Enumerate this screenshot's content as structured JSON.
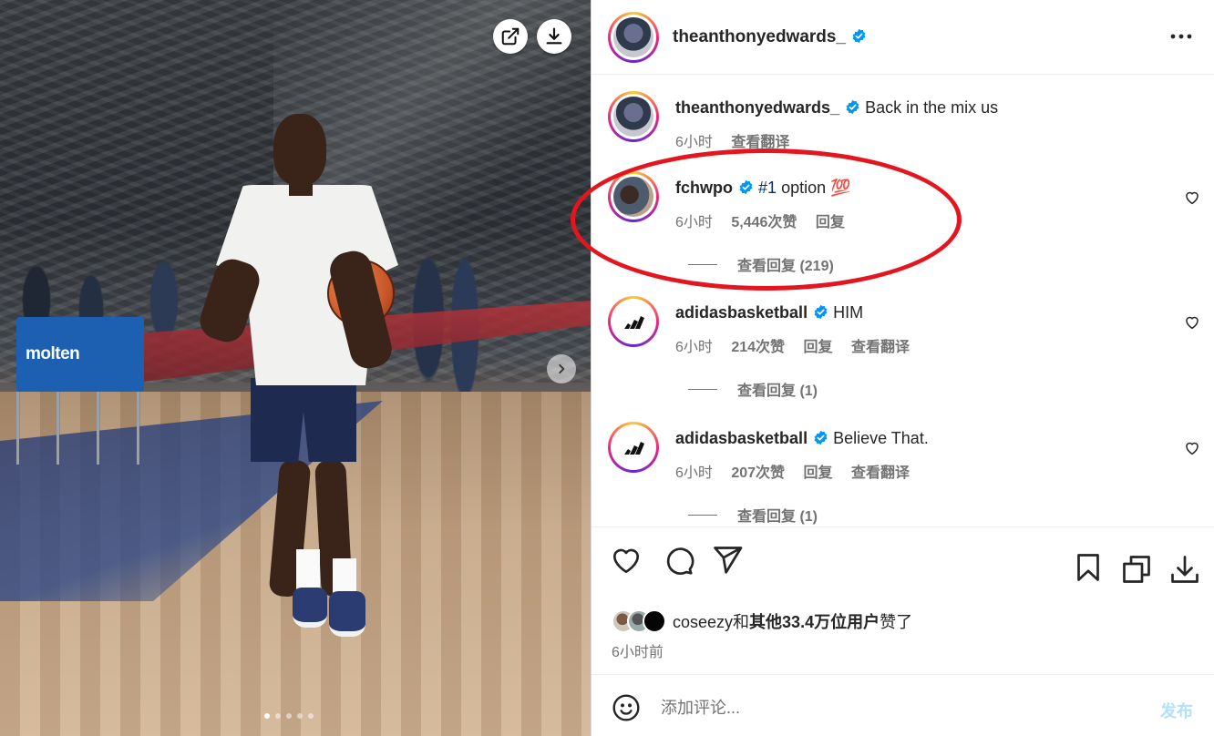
{
  "photo": {
    "bin_brand": "molten",
    "carousel_dot_count": 5,
    "carousel_active_index": 0,
    "icons": [
      "external-link-icon",
      "download-icon",
      "chevron-right-icon"
    ]
  },
  "post": {
    "author": "theanthonyedwards_",
    "verified": true
  },
  "comments": [
    {
      "username": "theanthonyedwards_",
      "verified": true,
      "text": "Back in the mix us",
      "time": "6小时",
      "translate": "查看翻译"
    },
    {
      "username": "fchwpo",
      "verified": true,
      "hashtag": "#1",
      "text": "option",
      "emoji": "💯",
      "time": "6小时",
      "likes": "5,446次赞",
      "reply": "回复",
      "view_replies": "查看回复 (219)"
    },
    {
      "username": "adidasbasketball",
      "verified": true,
      "text": "HIM",
      "time": "6小时",
      "likes": "214次赞",
      "reply": "回复",
      "translate": "查看翻译",
      "view_replies": "查看回复 (1)"
    },
    {
      "username": "adidasbasketball",
      "verified": true,
      "text": "Believe That.",
      "time": "6小时",
      "likes": "207次赞",
      "reply": "回复",
      "translate": "查看翻译",
      "view_replies": "查看回复 (1)"
    }
  ],
  "likes_summary": {
    "first_user": "coseezy",
    "connector": "和",
    "others": "其他33.4万位用户",
    "suffix": "赞了"
  },
  "post_time": "6小时前",
  "comment_input": {
    "placeholder": "添加评论...",
    "post_label": "发布"
  },
  "colors": {
    "verified": "#0095f6",
    "annotation": "#e4151f",
    "post_disabled": "#b2dffc",
    "secondary_text": "#737373",
    "hashtag": "#00376b"
  }
}
